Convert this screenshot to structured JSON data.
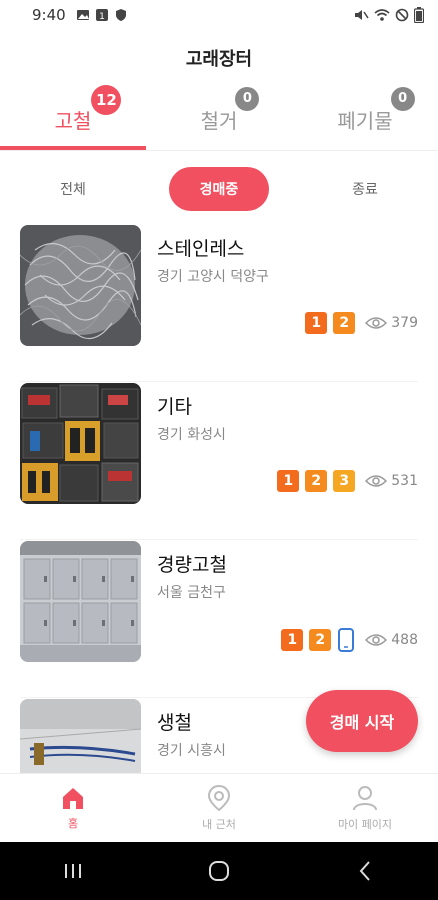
{
  "status_bar": {
    "time": "9:40"
  },
  "header": {
    "title": "고래장터"
  },
  "main_tabs": [
    {
      "label": "고철",
      "badge": "12"
    },
    {
      "label": "철거",
      "badge": "0"
    },
    {
      "label": "폐기물",
      "badge": "0"
    }
  ],
  "sub_tabs": [
    {
      "label": "전체"
    },
    {
      "label": "경매중"
    },
    {
      "label": "종료"
    }
  ],
  "listings": [
    {
      "title": "스테인레스",
      "location": "경기 고양시 덕양구",
      "badges": [
        "1",
        "2"
      ],
      "views": "379"
    },
    {
      "title": "기타",
      "location": "경기 화성시",
      "badges": [
        "1",
        "2",
        "3"
      ],
      "views": "531"
    },
    {
      "title": "경량고철",
      "location": "서울 금천구",
      "badges": [
        "1",
        "2"
      ],
      "views": "488"
    },
    {
      "title": "생철",
      "location": "경기 시흥시",
      "badges": [],
      "views": ""
    }
  ],
  "fab": {
    "label": "경매 시작"
  },
  "bottom_nav": [
    {
      "label": "홈"
    },
    {
      "label": "내 근처"
    },
    {
      "label": "마이 페이지"
    }
  ],
  "colors": {
    "accent": "#f0505f",
    "badge_1": "#f36b1c",
    "badge_2": "#f58a1f",
    "badge_3": "#f5a623",
    "phone_icon": "#3a7bd5"
  }
}
